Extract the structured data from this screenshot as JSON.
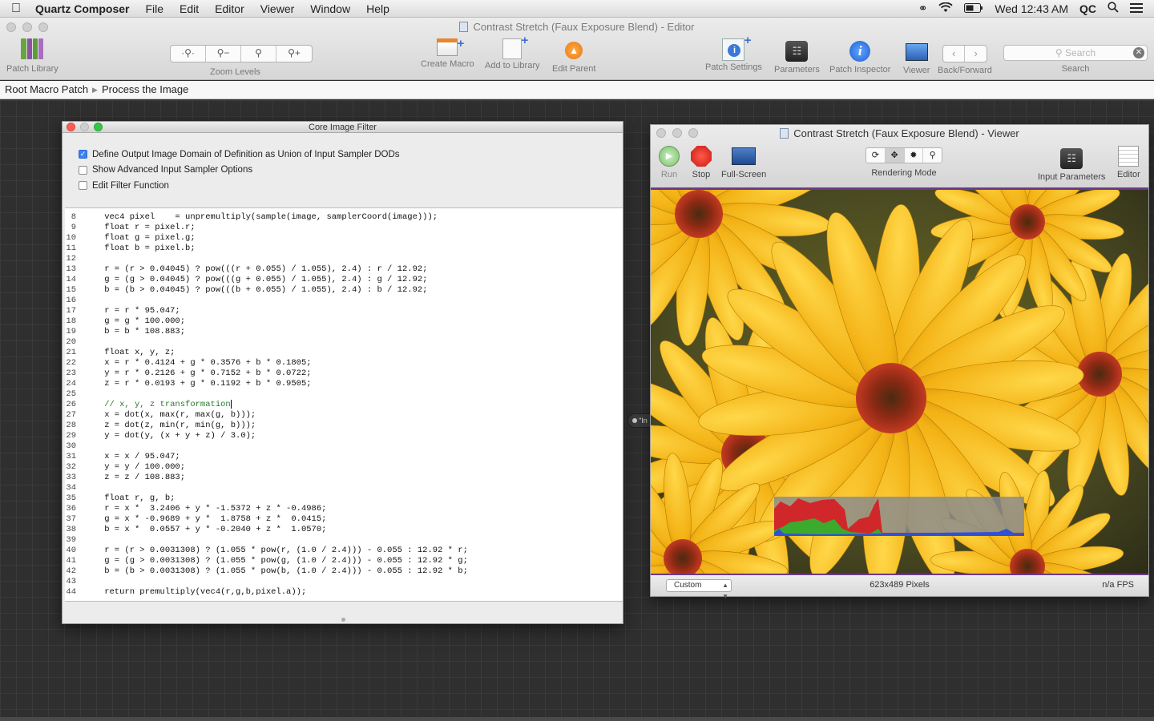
{
  "menubar": {
    "apple_icon": "apple-icon",
    "app_name": "Quartz Composer",
    "menus": [
      "File",
      "Edit",
      "Editor",
      "Viewer",
      "Window",
      "Help"
    ],
    "clock": "Wed 12:43 AM",
    "user": "QC"
  },
  "editor": {
    "title": "Contrast Stretch (Faux Exposure Blend) - Editor",
    "toolbar": {
      "patch_library": "Patch Library",
      "zoom_levels": "Zoom Levels",
      "create_macro": "Create Macro",
      "add_to_library": "Add to Library",
      "edit_parent": "Edit Parent",
      "patch_settings": "Patch Settings",
      "parameters": "Parameters",
      "patch_inspector": "Patch Inspector",
      "viewer": "Viewer",
      "back_forward": "Back/Forward",
      "search_label": "Search",
      "search_placeholder": "Search"
    },
    "breadcrumb": [
      "Root Macro Patch",
      "Process the Image"
    ]
  },
  "core_image_filter": {
    "title": "Core Image Filter",
    "options": [
      {
        "label": "Define Output Image Domain of Definition as Union of Input Sampler DODs",
        "checked": true
      },
      {
        "label": "Show Advanced Input Sampler Options",
        "checked": false
      },
      {
        "label": "Edit Filter Function",
        "checked": false
      }
    ],
    "code": [
      {
        "n": "8",
        "t": "    vec4 pixel    = unpremultiply(sample(image, samplerCoord(image)));"
      },
      {
        "n": "9",
        "t": "    float r = pixel.r;"
      },
      {
        "n": "10",
        "t": "    float g = pixel.g;"
      },
      {
        "n": "11",
        "t": "    float b = pixel.b;"
      },
      {
        "n": "12",
        "t": ""
      },
      {
        "n": "13",
        "t": "    r = (r > 0.04045) ? pow(((r + 0.055) / 1.055), 2.4) : r / 12.92;"
      },
      {
        "n": "14",
        "t": "    g = (g > 0.04045) ? pow(((g + 0.055) / 1.055), 2.4) : g / 12.92;"
      },
      {
        "n": "15",
        "t": "    b = (b > 0.04045) ? pow(((b + 0.055) / 1.055), 2.4) : b / 12.92;"
      },
      {
        "n": "16",
        "t": ""
      },
      {
        "n": "17",
        "t": "    r = r * 95.047;"
      },
      {
        "n": "18",
        "t": "    g = g * 100.000;"
      },
      {
        "n": "19",
        "t": "    b = b * 108.883;"
      },
      {
        "n": "20",
        "t": ""
      },
      {
        "n": "21",
        "t": "    float x, y, z;"
      },
      {
        "n": "22",
        "t": "    x = r * 0.4124 + g * 0.3576 + b * 0.1805;"
      },
      {
        "n": "23",
        "t": "    y = r * 0.2126 + g * 0.7152 + b * 0.0722;"
      },
      {
        "n": "24",
        "t": "    z = r * 0.0193 + g * 0.1192 + b * 0.9505;"
      },
      {
        "n": "25",
        "t": ""
      },
      {
        "n": "26",
        "t": "    // x, y, z transformation",
        "comment": true,
        "caret": true
      },
      {
        "n": "27",
        "t": "    x = dot(x, max(r, max(g, b)));"
      },
      {
        "n": "28",
        "t": "    z = dot(z, min(r, min(g, b)));"
      },
      {
        "n": "29",
        "t": "    y = dot(y, (x + y + z) / 3.0);"
      },
      {
        "n": "30",
        "t": ""
      },
      {
        "n": "31",
        "t": "    x = x / 95.047;"
      },
      {
        "n": "32",
        "t": "    y = y / 100.000;"
      },
      {
        "n": "33",
        "t": "    z = z / 108.883;"
      },
      {
        "n": "34",
        "t": ""
      },
      {
        "n": "35",
        "t": "    float r, g, b;"
      },
      {
        "n": "36",
        "t": "    r = x *  3.2406 + y * -1.5372 + z * -0.4986;"
      },
      {
        "n": "37",
        "t": "    g = x * -0.9689 + y *  1.8758 + z *  0.0415;"
      },
      {
        "n": "38",
        "t": "    b = x *  0.0557 + y * -0.2040 + z *  1.0570;"
      },
      {
        "n": "39",
        "t": ""
      },
      {
        "n": "40",
        "t": "    r = (r > 0.0031308) ? (1.055 * pow(r, (1.0 / 2.4))) - 0.055 : 12.92 * r;"
      },
      {
        "n": "41",
        "t": "    g = (g > 0.0031308) ? (1.055 * pow(g, (1.0 / 2.4))) - 0.055 : 12.92 * g;"
      },
      {
        "n": "42",
        "t": "    b = (b > 0.0031308) ? (1.055 * pow(b, (1.0 / 2.4))) - 0.055 : 12.92 * b;"
      },
      {
        "n": "43",
        "t": ""
      },
      {
        "n": "44",
        "t": "    return premultiply(vec4(r,g,b,pixel.a));"
      }
    ]
  },
  "port_node": {
    "label": "\"In"
  },
  "viewer": {
    "title": "Contrast Stretch (Faux Exposure Blend) - Viewer",
    "toolbar": {
      "run": "Run",
      "stop": "Stop",
      "full_screen": "Full-Screen",
      "rendering_mode": "Rendering Mode",
      "input_parameters": "Input Parameters",
      "editor": "Editor"
    },
    "status": {
      "mode": "Custom",
      "size": "623x489 Pixels",
      "fps": "n/a FPS"
    }
  },
  "colors": {
    "accent_blue": "#3e82f0",
    "viewer_border": "#6c3a8e",
    "comment_green": "#2a7a2a"
  }
}
